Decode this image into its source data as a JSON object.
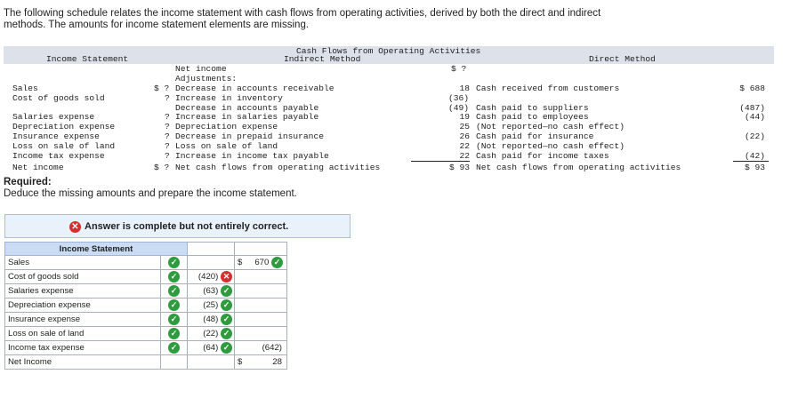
{
  "intro": {
    "line1": "The following schedule relates the income statement with cash flows from operating activities, derived by both the direct and indirect",
    "line2": "methods. The amounts for income statement elements are missing."
  },
  "schedule": {
    "header_left": "Income Statement",
    "header_mid_title": "Cash Flows from Operating Activities",
    "header_mid_sub": "Indirect Method",
    "header_right": "Direct Method",
    "is_items": [
      "Sales",
      "Cost of goods sold",
      "Salaries expense",
      "Depreciation expense",
      "Insurance expense",
      "Loss on sale of land",
      "Income tax expense",
      "Net income"
    ],
    "is_amts": [
      "$ ?",
      "?",
      "?",
      "?",
      "?",
      "?",
      "?",
      "$ ?"
    ],
    "net_income_label": "Net income",
    "adjustments_label": "Adjustments:",
    "ind_items": [
      "Decrease in accounts receivable",
      "Increase in inventory",
      "Decrease in accounts payable",
      "Increase in salaries payable",
      "Depreciation expense",
      "Decrease in prepaid insurance",
      "Loss on sale of land",
      "Increase in income tax payable",
      "Net cash flows from operating activities"
    ],
    "ind_net_income_amt": "$ ?",
    "ind_amts": [
      "18",
      "(36)",
      "(49)",
      "19",
      "25",
      "26",
      "22",
      "22",
      "$ 93"
    ],
    "dir_items": [
      "Cash received from customers",
      "Cash paid to suppliers",
      "Cash paid to employees",
      "(Not reported—no cash effect)",
      "Cash paid for insurance",
      "(Not reported—no cash effect)",
      "Cash paid for income taxes",
      "Net cash flows from operating activities"
    ],
    "dir_amts": [
      "$ 688",
      "(487)",
      "(44)",
      "(22)",
      "(42)",
      "$ 93"
    ]
  },
  "required_label": "Required:",
  "deduce_text": "Deduce the missing amounts and prepare the income statement.",
  "banner_text": "Answer is complete but not entirely correct.",
  "answer": {
    "header": "Income Statement",
    "labels": [
      "Sales",
      "Cost of goods sold",
      "Salaries expense",
      "Depreciation expense",
      "Insurance expense",
      "Loss on sale of land",
      "Income tax expense",
      "Net Income"
    ],
    "col3": [
      "",
      "(420)",
      "(63)",
      "(25)",
      "(48)",
      "(22)",
      "(64)",
      ""
    ],
    "dollar": "$",
    "sales_total": "670",
    "expense_total": "(642)",
    "net_income_total": "28"
  },
  "colors": {
    "correct": "#2e9b3e",
    "incorrect": "#d32f2f",
    "header_band": "#dde2ea",
    "answer_header": "#c9dcf3"
  }
}
